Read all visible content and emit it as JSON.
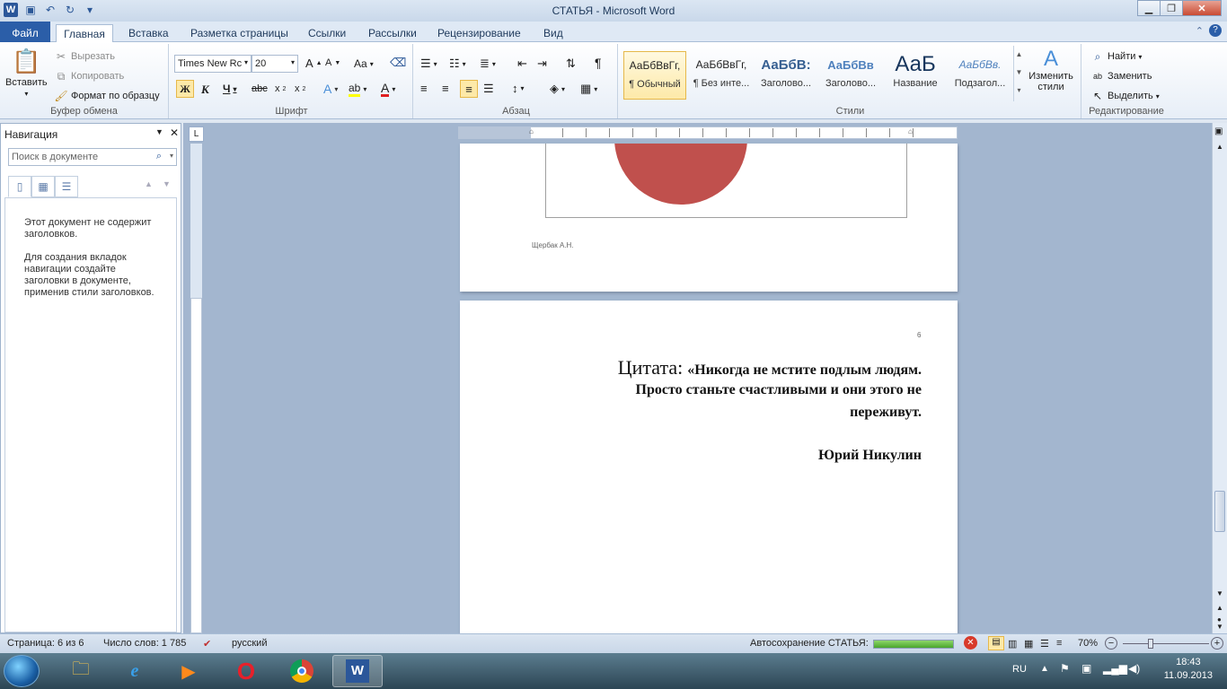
{
  "window": {
    "title": "СТАТЬЯ - Microsoft Word"
  },
  "tabs": [
    "Файл",
    "Главная",
    "Вставка",
    "Разметка страницы",
    "Ссылки",
    "Рассылки",
    "Рецензирование",
    "Вид"
  ],
  "clipboard": {
    "paste": "Вставить",
    "cut": "Вырезать",
    "copy": "Копировать",
    "format_painter": "Формат по образцу",
    "group_label": "Буфер обмена"
  },
  "font": {
    "name": "Times New Rc",
    "size": "20",
    "case_label": "Aa",
    "group_label": "Шрифт"
  },
  "paragraph": {
    "group_label": "Абзац"
  },
  "styles": {
    "items": [
      {
        "sample": "АаБбВвГг,",
        "name": "¶ Обычный"
      },
      {
        "sample": "АаБбВвГг,",
        "name": "¶ Без инте..."
      },
      {
        "sample": "АаБбВ:",
        "name": "Заголово..."
      },
      {
        "sample": "АаБбВв",
        "name": "Заголово..."
      },
      {
        "sample": "АаБ",
        "name": "Название"
      },
      {
        "sample": "АаБбВв.",
        "name": "Подзагол..."
      }
    ],
    "change_styles": "Изменить стили",
    "group_label": "Стили"
  },
  "editing": {
    "find": "Найти",
    "replace": "Заменить",
    "select": "Выделить",
    "group_label": "Редактирование"
  },
  "navigation": {
    "title": "Навигация",
    "search_placeholder": "Поиск в документе",
    "msg1": "Этот документ не содержит заголовков.",
    "msg2": "Для создания вкладок навигации создайте заголовки в документе, применив стили заголовков."
  },
  "document": {
    "footer_author": "Щербак А.Н.",
    "page_number": "6",
    "quote_label": "Цитата:",
    "quote_line1": "«Никогда не мстите подлым людям.",
    "quote_line2": "Просто станьте счастливыми и они этого не",
    "quote_line3": "переживут.",
    "author": "Юрий Никулин",
    "pie_color": "#c0504d"
  },
  "status": {
    "page": "Страница: 6 из 6",
    "words": "Число слов: 1 785",
    "language": "русский",
    "autosave": "Автосохранение СТАТЬЯ:",
    "autosave_progress": 1.0,
    "zoom": "70%"
  },
  "taskbar": {
    "lang": "RU",
    "time": "18:43",
    "date": "11.09.2013"
  }
}
